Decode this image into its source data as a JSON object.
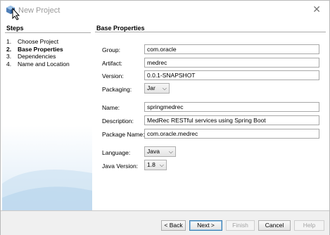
{
  "window": {
    "title": "New Project"
  },
  "steps": {
    "heading": "Steps",
    "items": [
      {
        "num": "1.",
        "label": "Choose Project",
        "active": false
      },
      {
        "num": "2.",
        "label": "Base Properties",
        "active": true
      },
      {
        "num": "3.",
        "label": "Dependencies",
        "active": false
      },
      {
        "num": "4.",
        "label": "Name and Location",
        "active": false
      }
    ]
  },
  "main": {
    "heading": "Base Properties",
    "group": {
      "label": "Group:",
      "value": "com.oracle"
    },
    "artifact": {
      "label": "Artifact:",
      "value": "medrec"
    },
    "version": {
      "label": "Version:",
      "value": "0.0.1-SNAPSHOT"
    },
    "packaging": {
      "label": "Packaging:",
      "value": "Jar"
    },
    "name": {
      "label": "Name:",
      "value": "springmedrec"
    },
    "description": {
      "label": "Description:",
      "value": "MedRec RESTful services using Spring Boot"
    },
    "package_name": {
      "label": "Package Name:",
      "value": "com.oracle.medrec"
    },
    "language": {
      "label": "Language:",
      "value": "Java"
    },
    "java_version": {
      "label": "Java Version:",
      "value": "1.8"
    }
  },
  "buttons": {
    "back": "< Back",
    "next": "Next >",
    "finish": "Finish",
    "cancel": "Cancel",
    "help": "Help"
  },
  "icons": {
    "app": "netbeans-cube-icon",
    "close": "close-icon",
    "dropdown": "chevron-down-icon"
  }
}
